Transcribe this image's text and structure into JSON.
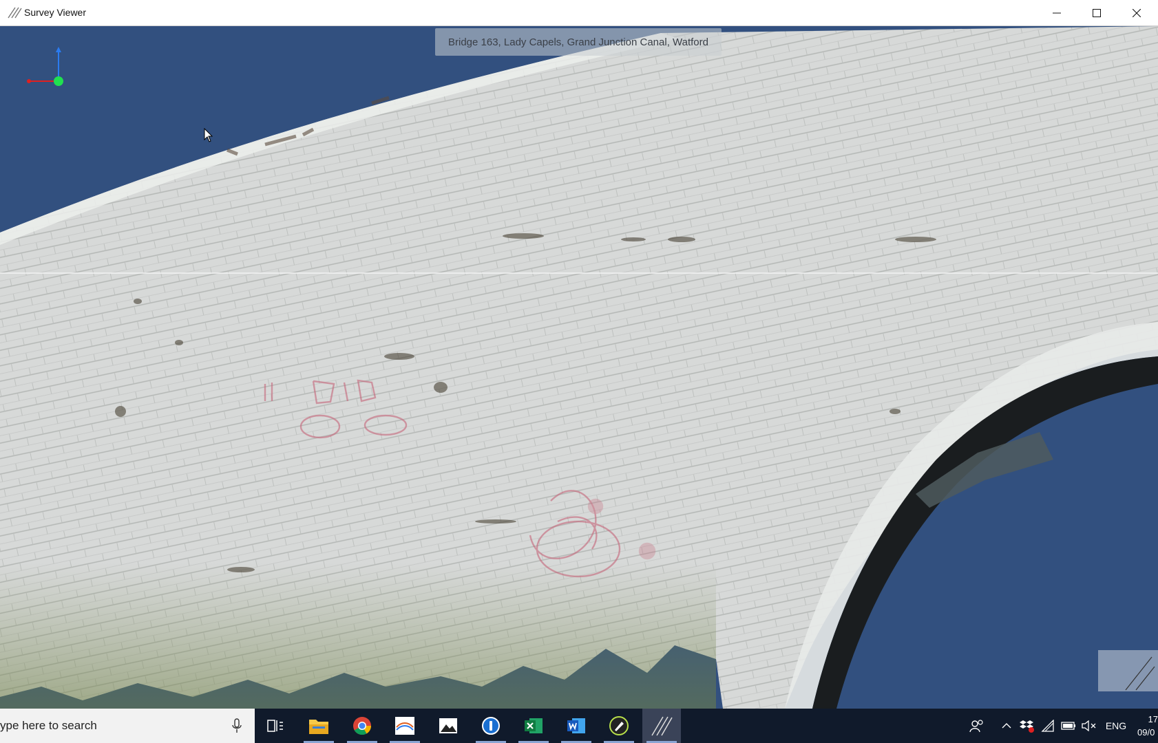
{
  "window": {
    "title": "Survey Viewer",
    "icon": "survey-viewer-app-icon",
    "controls": {
      "minimize": "minimize-icon",
      "maximize": "maximize-icon",
      "close": "close-icon"
    }
  },
  "viewport": {
    "caption": "Bridge 163, Lady Capels, Grand Junction Canal, Watford",
    "background_color": "#32507f",
    "axes": {
      "x_color": "#e02020",
      "y_color": "#2a7bf0",
      "z_color": "#20e050"
    }
  },
  "taskbar": {
    "search_placeholder": "ype here to search",
    "apps": [
      {
        "name": "task-view-icon",
        "active": false
      },
      {
        "name": "file-explorer-icon",
        "active": true
      },
      {
        "name": "chrome-icon",
        "active": true
      },
      {
        "name": "survey-app-icon",
        "active": true
      },
      {
        "name": "photos-icon",
        "active": false
      },
      {
        "name": "password-manager-icon",
        "active": true
      },
      {
        "name": "excel-icon",
        "active": true
      },
      {
        "name": "word-icon",
        "active": true
      },
      {
        "name": "pen-tool-icon",
        "active": true
      },
      {
        "name": "survey-viewer-icon",
        "active": true
      }
    ],
    "tray": {
      "language": "ENG",
      "time": "17",
      "date": "09/0"
    }
  }
}
